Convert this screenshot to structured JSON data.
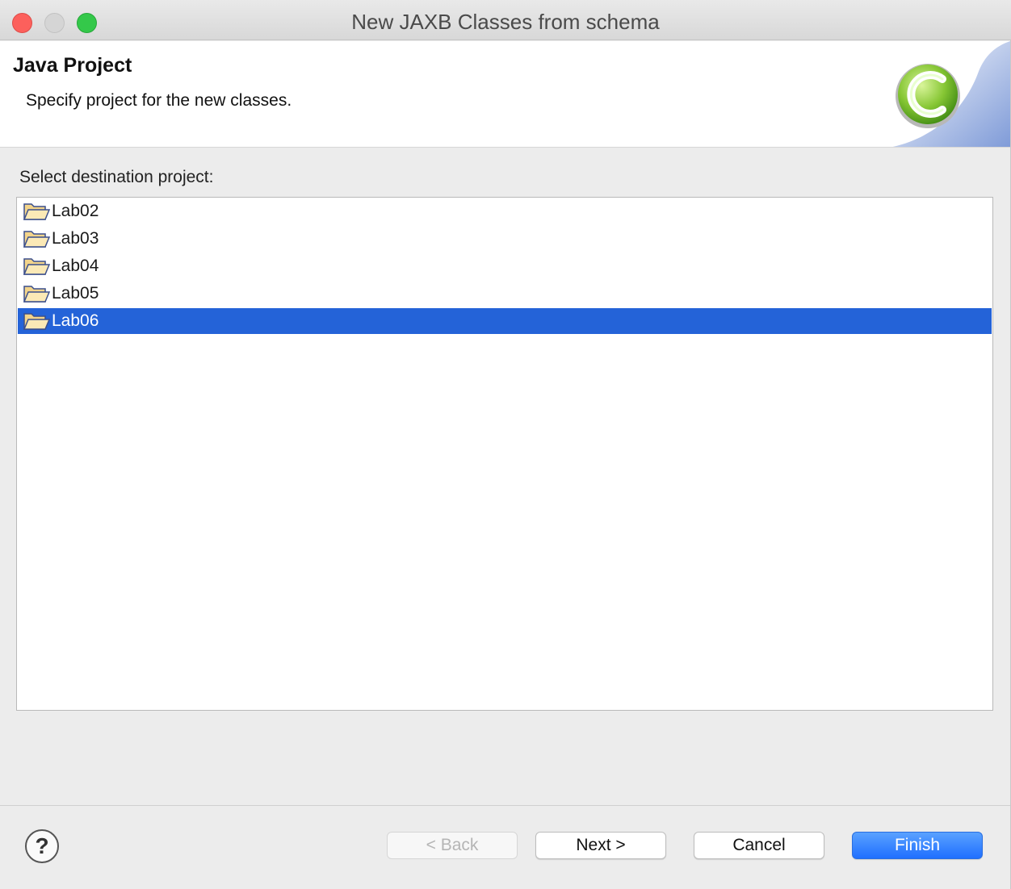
{
  "window": {
    "title": "New JAXB Classes from schema"
  },
  "banner": {
    "title": "Java Project",
    "description": "Specify project for the new classes.",
    "icon": "jaxb-class-c-icon"
  },
  "content": {
    "list_label": "Select destination project:",
    "projects": [
      {
        "label": "Lab02",
        "icon": "open-folder-icon",
        "selected": false
      },
      {
        "label": "Lab03",
        "icon": "open-folder-icon",
        "selected": false
      },
      {
        "label": "Lab04",
        "icon": "open-folder-icon",
        "selected": false
      },
      {
        "label": "Lab05",
        "icon": "open-folder-icon",
        "selected": false
      },
      {
        "label": "Lab06",
        "icon": "open-folder-icon",
        "selected": true
      }
    ]
  },
  "footer": {
    "help_label": "?",
    "back_label": "< Back",
    "back_enabled": false,
    "next_label": "Next >",
    "cancel_label": "Cancel",
    "finish_label": "Finish"
  },
  "colors": {
    "selection": "#2463d8",
    "finish_button": "#1f6fff",
    "close": "#fc605c",
    "maximize": "#34c84a"
  }
}
